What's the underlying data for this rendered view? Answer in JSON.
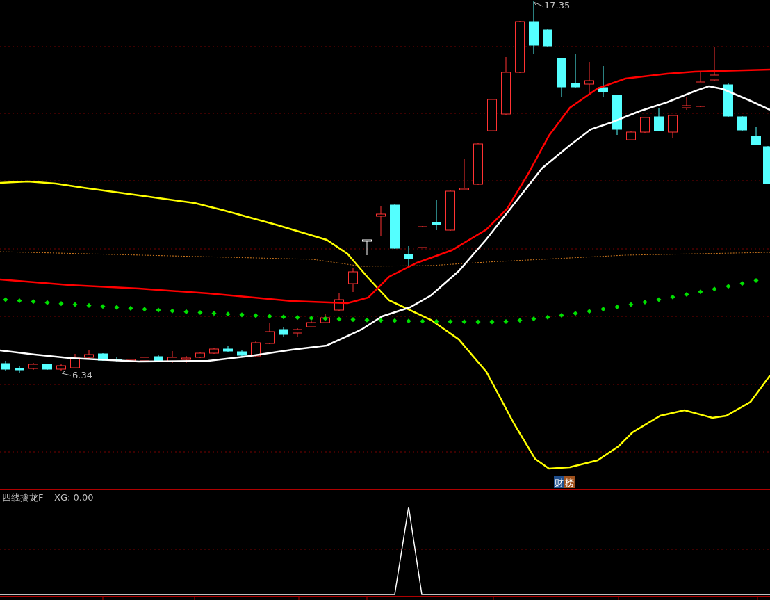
{
  "main_chart": {
    "high_label": "17.35",
    "low_label": "6.34",
    "signal_tags": [
      "财",
      "榜"
    ]
  },
  "indicator": {
    "name": "四线擒龙F",
    "readout": "XG: 0.00"
  }
}
